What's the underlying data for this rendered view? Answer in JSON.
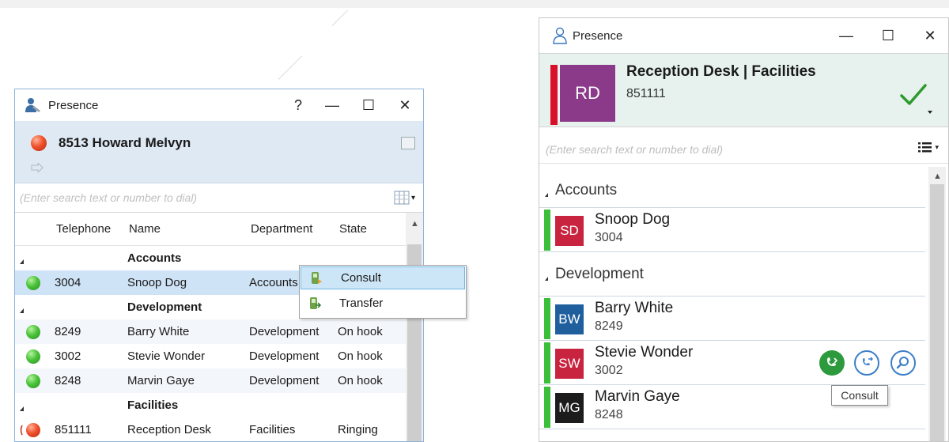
{
  "left_window": {
    "title": "Presence",
    "help_glyph": "?",
    "minimize_glyph": "—",
    "maximize_glyph": "☐",
    "close_glyph": "✕",
    "user": {
      "extension": "8513",
      "name": "Howard Melvyn",
      "display": "8513 Howard Melvyn",
      "status_color": "#f0512b"
    },
    "search_placeholder": "(Enter search text or number to dial)",
    "columns": {
      "telephone": "Telephone",
      "name": "Name",
      "department": "Department",
      "state": "State"
    },
    "groups": [
      {
        "name": "Accounts",
        "rows": [
          {
            "telephone": "3004",
            "name": "Snoop Dog",
            "department": "Accounts",
            "state": "",
            "status": "green",
            "selected": true
          }
        ]
      },
      {
        "name": "Development",
        "rows": [
          {
            "telephone": "8249",
            "name": "Barry White",
            "department": "Development",
            "state": "On hook",
            "status": "green"
          },
          {
            "telephone": "3002",
            "name": "Stevie Wonder",
            "department": "Development",
            "state": "On hook",
            "status": "green"
          },
          {
            "telephone": "8248",
            "name": "Marvin Gaye",
            "department": "Development",
            "state": "On hook",
            "status": "green"
          }
        ]
      },
      {
        "name": "Facilities",
        "rows": [
          {
            "telephone": "851111",
            "name": "Reception Desk",
            "department": "Facilities",
            "state": "Ringing",
            "status": "ringing"
          }
        ]
      }
    ],
    "context_menu": {
      "items": [
        {
          "label": "Consult",
          "highlighted": true
        },
        {
          "label": "Transfer"
        }
      ]
    }
  },
  "right_window": {
    "title": "Presence",
    "minimize_glyph": "—",
    "maximize_glyph": "☐",
    "close_glyph": "✕",
    "me": {
      "initials": "RD",
      "name": "Reception Desk | Facilities",
      "number": "851111",
      "status_bar_color": "#d8102a",
      "avatar_color": "#8a3a88",
      "check_color": "#2e9a2e"
    },
    "search_placeholder": "(Enter search text or number to dial)",
    "groups": [
      {
        "name": "Accounts",
        "contacts": [
          {
            "initials": "SD",
            "name": "Snoop Dog",
            "ext": "3004",
            "avatar_color": "#c8243f"
          }
        ]
      },
      {
        "name": "Development",
        "contacts": [
          {
            "initials": "BW",
            "name": "Barry White",
            "ext": "8249",
            "avatar_color": "#1f5f9e"
          },
          {
            "initials": "SW",
            "name": "Stevie Wonder",
            "ext": "3002",
            "avatar_color": "#c8243f"
          },
          {
            "initials": "MG",
            "name": "Marvin Gaye",
            "ext": "8248",
            "avatar_color": "#1c1c1c"
          }
        ]
      }
    ],
    "actions": [
      {
        "icon": "consult-icon"
      },
      {
        "icon": "transfer-icon"
      },
      {
        "icon": "search-icon"
      }
    ],
    "tooltip": "Consult"
  }
}
